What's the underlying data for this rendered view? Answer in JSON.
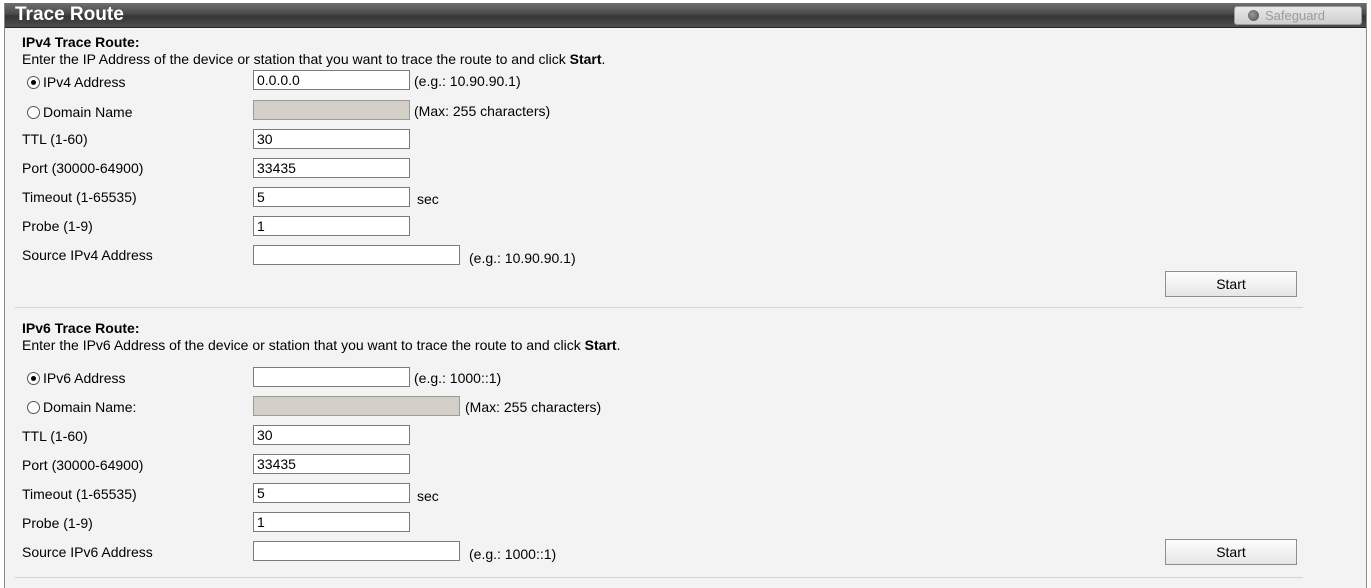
{
  "window": {
    "title": "Trace Route",
    "safeguard_label": "Safeguard"
  },
  "ipv4": {
    "heading": "IPv4 Trace Route:",
    "intro": "Enter the IP Address of the device or station that you want to trace the route to and click ",
    "intro_bold": "Start",
    "intro_end": ".",
    "addr_label": "IPv4 Address",
    "addr_value": "0.0.0.0",
    "addr_hint": "(e.g.: 10.90.90.1)",
    "domain_label": "Domain Name",
    "domain_hint": "(Max: 255 characters)",
    "ttl_label": "TTL (1-60)",
    "ttl_value": "30",
    "port_label": "Port (30000-64900)",
    "port_value": "33435",
    "timeout_label": "Timeout (1-65535)",
    "timeout_value": "5",
    "timeout_unit": "sec",
    "probe_label": "Probe (1-9)",
    "probe_value": "1",
    "source_label": "Source IPv4 Address",
    "source_value": "",
    "source_hint": "(e.g.: 10.90.90.1)",
    "start_label": "Start"
  },
  "ipv6": {
    "heading": "IPv6 Trace Route:",
    "intro": "Enter the IPv6 Address of the device or station that you want to trace the route to and click ",
    "intro_bold": "Start",
    "intro_end": ".",
    "addr_label": "IPv6 Address",
    "addr_value": "",
    "addr_hint": "(e.g.: 1000::1)",
    "domain_label": "Domain Name:",
    "domain_hint": "(Max: 255 characters)",
    "ttl_label": "TTL (1-60)",
    "ttl_value": "30",
    "port_label": "Port (30000-64900)",
    "port_value": "33435",
    "timeout_label": "Timeout (1-65535)",
    "timeout_value": "5",
    "timeout_unit": "sec",
    "probe_label": "Probe (1-9)",
    "probe_value": "1",
    "source_label": "Source IPv6 Address",
    "source_value": "",
    "source_hint": "(e.g.: 1000::1)",
    "start_label": "Start"
  }
}
